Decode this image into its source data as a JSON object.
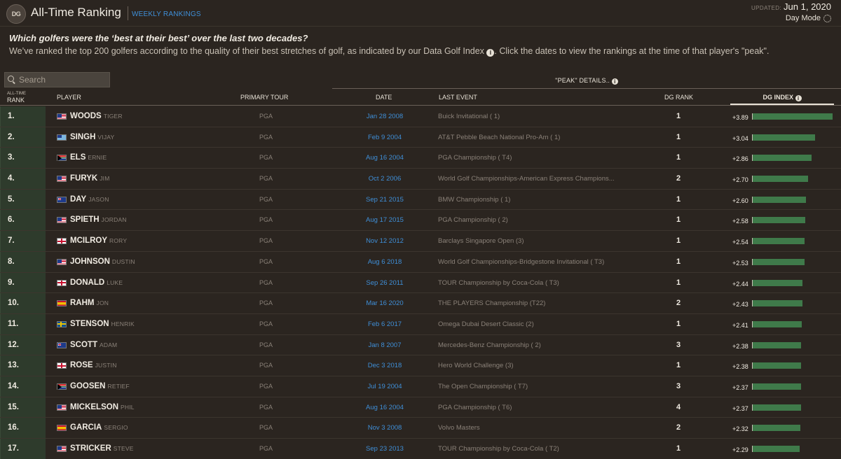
{
  "header": {
    "logo_text": "DG",
    "title": "All-Time Ranking",
    "weekly_link": "WEEKLY RANKINGS",
    "updated_label": "UPDATED:",
    "updated_date": "Jun 1, 2020",
    "day_mode": "Day Mode"
  },
  "intro": {
    "headline": "Which golfers were the ‘best at their best’ over the last two decades?",
    "text_before_icon": "We’ve ranked the top 200 golfers according to the quality of their best stretches of golf, as indicated by our Data Golf Index",
    "text_after_icon": ". Click the dates to view the rankings at the time of that player's \"peak\".",
    "info_glyph": "i"
  },
  "search": {
    "placeholder": "Search",
    "value": ""
  },
  "table": {
    "peak_label": "\"PEAK\" DETAILS..",
    "headers": {
      "rank_small": "ALL-TIME",
      "rank": "RANK",
      "player": "PLAYER",
      "tour": "PRIMARY TOUR",
      "date": "DATE",
      "event": "LAST EVENT",
      "dg_rank": "DG RANK",
      "dg_index": "DG INDEX"
    },
    "index_max": 3.89,
    "rows": [
      {
        "rank": "1.",
        "last": "WOODS",
        "first": "TIGER",
        "flag": "us",
        "tour": "PGA",
        "date": "Jan 28 2008",
        "event": "Buick Invitational ( 1)",
        "dg_rank": "1",
        "dg_index": "+3.89",
        "value": 3.89
      },
      {
        "rank": "2.",
        "last": "SINGH",
        "first": "VIJAY",
        "flag": "fj",
        "tour": "PGA",
        "date": "Feb 9 2004",
        "event": "AT&T Pebble Beach National Pro-Am ( 1)",
        "dg_rank": "1",
        "dg_index": "+3.04",
        "value": 3.04
      },
      {
        "rank": "3.",
        "last": "ELS",
        "first": "ERNIE",
        "flag": "za",
        "tour": "PGA",
        "date": "Aug 16 2004",
        "event": "PGA Championship ( T4)",
        "dg_rank": "1",
        "dg_index": "+2.86",
        "value": 2.86
      },
      {
        "rank": "4.",
        "last": "FURYK",
        "first": "JIM",
        "flag": "us",
        "tour": "PGA",
        "date": "Oct 2 2006",
        "event": "World Golf Championships-American Express Champions...",
        "dg_rank": "2",
        "dg_index": "+2.70",
        "value": 2.7
      },
      {
        "rank": "5.",
        "last": "DAY",
        "first": "JASON",
        "flag": "au",
        "tour": "PGA",
        "date": "Sep 21 2015",
        "event": "BMW Championship ( 1)",
        "dg_rank": "1",
        "dg_index": "+2.60",
        "value": 2.6
      },
      {
        "rank": "6.",
        "last": "SPIETH",
        "first": "JORDAN",
        "flag": "us",
        "tour": "PGA",
        "date": "Aug 17 2015",
        "event": "PGA Championship ( 2)",
        "dg_rank": "1",
        "dg_index": "+2.58",
        "value": 2.58
      },
      {
        "rank": "7.",
        "last": "MCILROY",
        "first": "RORY",
        "flag": "en",
        "tour": "PGA",
        "date": "Nov 12 2012",
        "event": "Barclays Singapore Open (3)",
        "dg_rank": "1",
        "dg_index": "+2.54",
        "value": 2.54
      },
      {
        "rank": "8.",
        "last": "JOHNSON",
        "first": "DUSTIN",
        "flag": "us",
        "tour": "PGA",
        "date": "Aug 6 2018",
        "event": "World Golf Championships-Bridgestone Invitational ( T3)",
        "dg_rank": "1",
        "dg_index": "+2.53",
        "value": 2.53
      },
      {
        "rank": "9.",
        "last": "DONALD",
        "first": "LUKE",
        "flag": "en",
        "tour": "PGA",
        "date": "Sep 26 2011",
        "event": "TOUR Championship by Coca-Cola ( T3)",
        "dg_rank": "1",
        "dg_index": "+2.44",
        "value": 2.44
      },
      {
        "rank": "10.",
        "last": "RAHM",
        "first": "JON",
        "flag": "es",
        "tour": "PGA",
        "date": "Mar 16 2020",
        "event": "THE PLAYERS Championship (T22)",
        "dg_rank": "2",
        "dg_index": "+2.43",
        "value": 2.43
      },
      {
        "rank": "11.",
        "last": "STENSON",
        "first": "HENRIK",
        "flag": "se",
        "tour": "PGA",
        "date": "Feb 6 2017",
        "event": "Omega Dubai Desert Classic (2)",
        "dg_rank": "1",
        "dg_index": "+2.41",
        "value": 2.41
      },
      {
        "rank": "12.",
        "last": "SCOTT",
        "first": "ADAM",
        "flag": "au",
        "tour": "PGA",
        "date": "Jan 8 2007",
        "event": "Mercedes-Benz Championship ( 2)",
        "dg_rank": "3",
        "dg_index": "+2.38",
        "value": 2.38
      },
      {
        "rank": "13.",
        "last": "ROSE",
        "first": "JUSTIN",
        "flag": "en",
        "tour": "PGA",
        "date": "Dec 3 2018",
        "event": "Hero World Challenge (3)",
        "dg_rank": "1",
        "dg_index": "+2.38",
        "value": 2.38
      },
      {
        "rank": "14.",
        "last": "GOOSEN",
        "first": "RETIEF",
        "flag": "za",
        "tour": "PGA",
        "date": "Jul 19 2004",
        "event": "The Open Championship ( T7)",
        "dg_rank": "3",
        "dg_index": "+2.37",
        "value": 2.37
      },
      {
        "rank": "15.",
        "last": "MICKELSON",
        "first": "PHIL",
        "flag": "us",
        "tour": "PGA",
        "date": "Aug 16 2004",
        "event": "PGA Championship ( T6)",
        "dg_rank": "4",
        "dg_index": "+2.37",
        "value": 2.37
      },
      {
        "rank": "16.",
        "last": "GARCIA",
        "first": "SERGIO",
        "flag": "es",
        "tour": "PGA",
        "date": "Nov 3 2008",
        "event": "Volvo Masters",
        "dg_rank": "2",
        "dg_index": "+2.32",
        "value": 2.32
      },
      {
        "rank": "17.",
        "last": "STRICKER",
        "first": "STEVE",
        "flag": "us",
        "tour": "PGA",
        "date": "Sep 23 2013",
        "event": "TOUR Championship by Coca-Cola ( T2)",
        "dg_rank": "1",
        "dg_index": "+2.29",
        "value": 2.29
      }
    ]
  },
  "colors": {
    "background": "#2b2520",
    "bar": "#3f7a4a",
    "link": "#3f8fd8",
    "rank_cell": "#2e3b2c"
  }
}
